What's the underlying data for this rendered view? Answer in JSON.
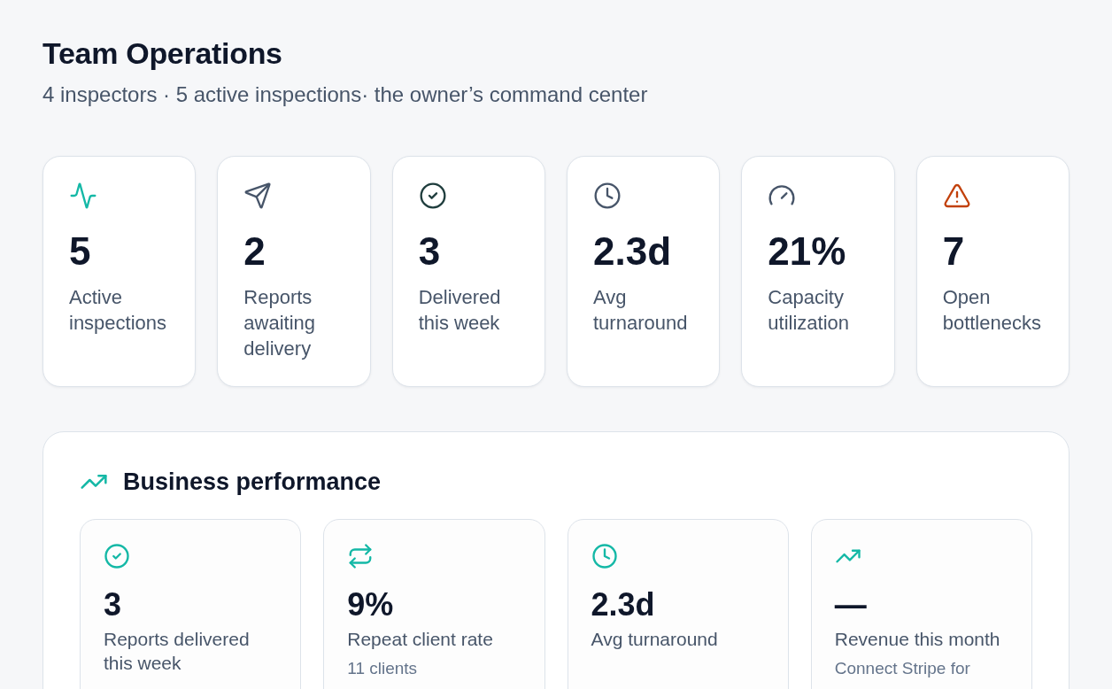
{
  "header": {
    "title": "Team Operations",
    "subtitle": "4 inspectors · 5 active inspections· the owner’s command center"
  },
  "kpi_cards": [
    {
      "value": "5",
      "label": "Active inspections",
      "color": "#14b8a6"
    },
    {
      "value": "2",
      "label": "Reports awaiting delivery",
      "color": "#475569"
    },
    {
      "value": "3",
      "label": "Delivered this week",
      "color": "#1f3d3d"
    },
    {
      "value": "2.3d",
      "label": "Avg turnaround",
      "color": "#475569"
    },
    {
      "value": "21%",
      "label": "Capacity utilization",
      "color": "#475569"
    },
    {
      "value": "7",
      "label": "Open bottlenecks",
      "color": "#c2410c"
    }
  ],
  "business_performance": {
    "title": "Business performance",
    "cards": [
      {
        "value": "3",
        "label": "Reports delivered this week"
      },
      {
        "value": "9%",
        "label": "Repeat client rate",
        "note": "11 clients"
      },
      {
        "value": "2.3d",
        "label": "Avg turnaround"
      },
      {
        "value": "—",
        "label": "Revenue this month",
        "note": "Connect Stripe for"
      }
    ]
  }
}
